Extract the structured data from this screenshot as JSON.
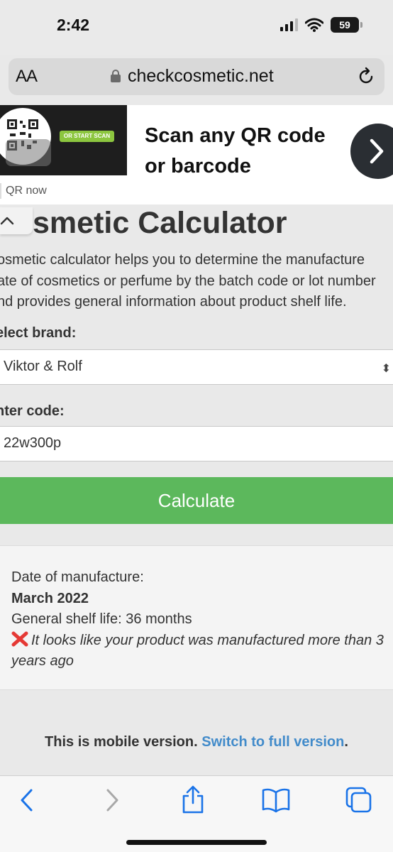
{
  "status_bar": {
    "time": "2:42",
    "battery": "59",
    "icons": [
      "signal-icon",
      "wifi-icon",
      "battery-icon"
    ]
  },
  "browser": {
    "text_size_button": "AA",
    "url": "checkcosmetic.net",
    "icons": [
      "lock-icon",
      "reload-icon"
    ]
  },
  "ad": {
    "pill_text": "OR START SCAN",
    "headline": "Scan any QR code or barcode",
    "caption": "QR now",
    "icons": [
      "qr-code-icon",
      "chevron-right-icon"
    ]
  },
  "page": {
    "title": "smetic Calculator",
    "intro": "osmetic calculator helps you to determine the manufacture\nate of cosmetics or perfume by the batch code or lot number\nnd provides general information about product shelf life.",
    "brand_label": "elect brand:",
    "brand_value": "Viktor & Rolf",
    "code_label": "nter code:",
    "code_value": "22w300p",
    "calculate_label": "Calculate"
  },
  "result": {
    "date_label": "Date of manufacture:",
    "date_value": "March 2022",
    "shelf_life": "General shelf life: 36 months",
    "warning": "It looks like your product was manufactured more than 3 years ago"
  },
  "footer": {
    "mobile_notice": "This is mobile version.",
    "switch_link": "Switch to full version",
    "period": "."
  },
  "toolbar": {
    "icons": [
      "back-icon",
      "forward-icon",
      "share-icon",
      "bookmarks-icon",
      "tabs-icon"
    ]
  },
  "colors": {
    "calculate_button": "#5cb85c",
    "link": "#428bca",
    "toolbar_icon": "#1a73e8",
    "warning_cross": "#e53935"
  }
}
